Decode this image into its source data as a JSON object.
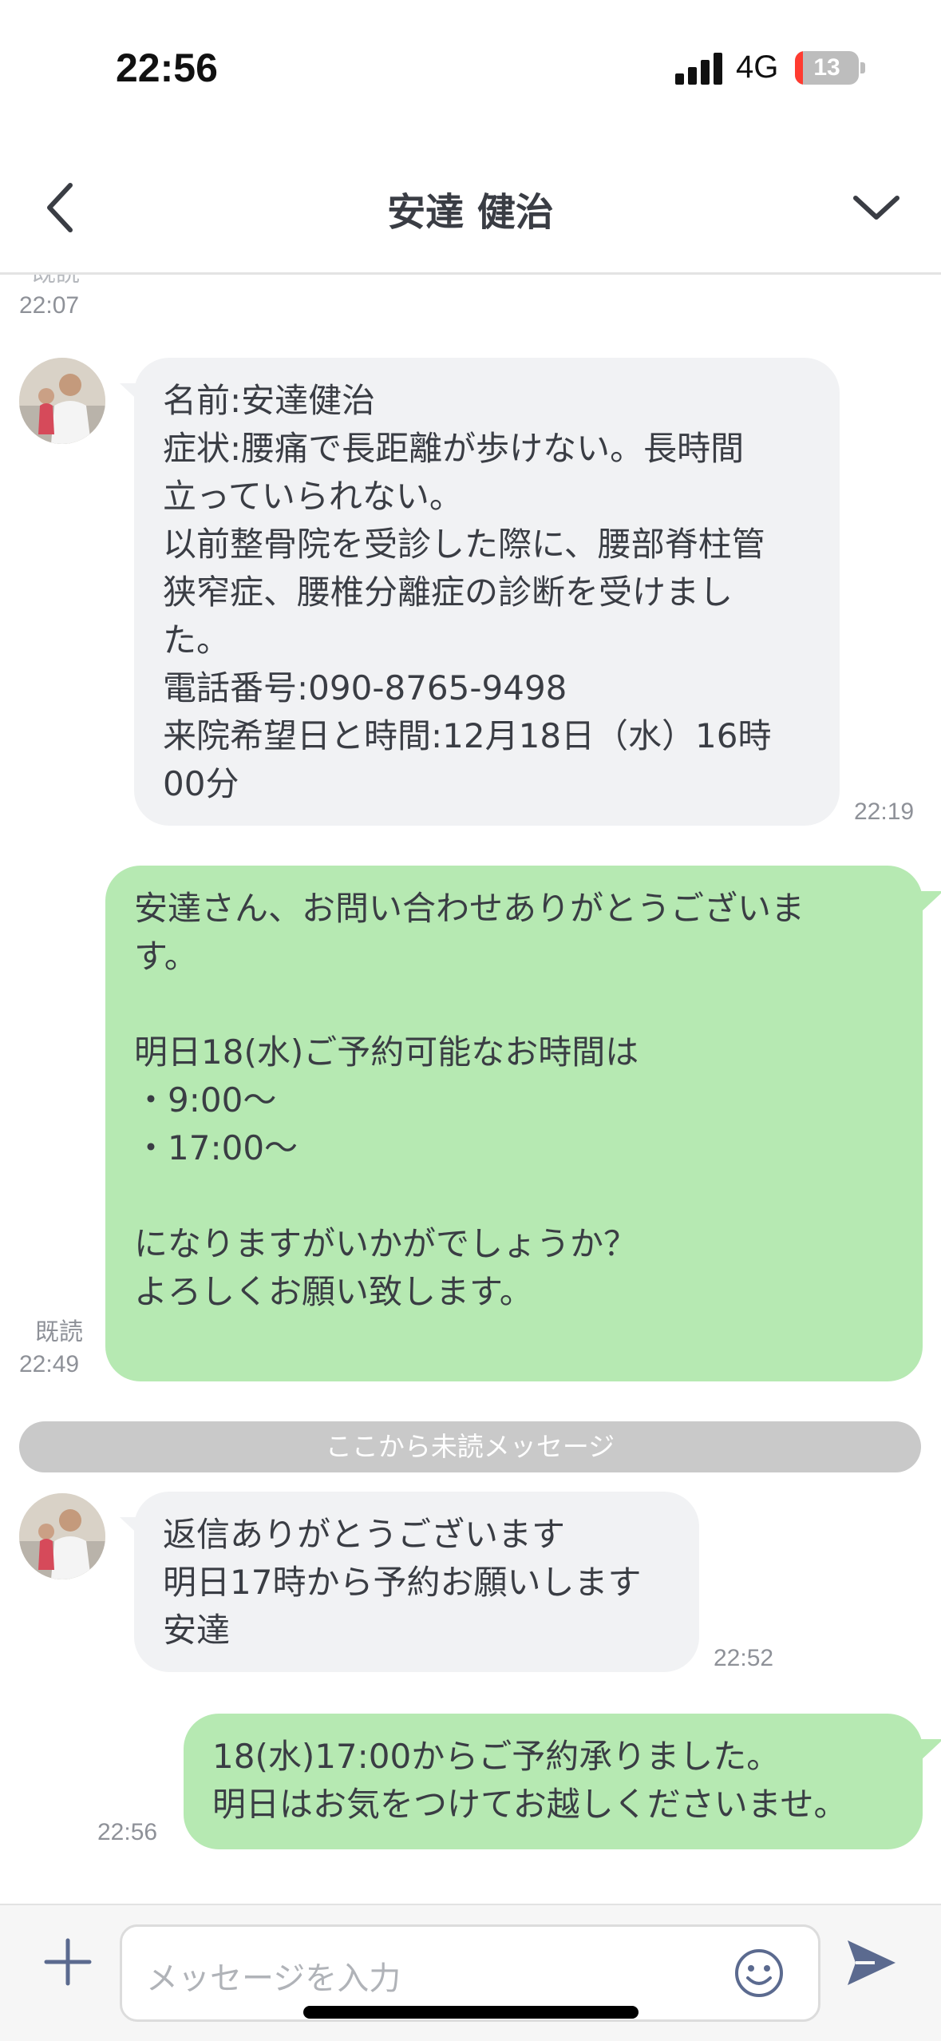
{
  "status_bar": {
    "time": "22:56",
    "network": "4G",
    "battery_level": "13",
    "battery_fraction": 0.13
  },
  "header": {
    "title": "安達 健治",
    "back_icon": "chevron-left-icon",
    "menu_icon": "chevron-down-icon"
  },
  "chat": {
    "top_partial": {
      "read_label": "既読",
      "time": "22:07"
    },
    "messages": [
      {
        "direction": "in",
        "text": "名前:安達健治\n症状:腰痛で長距離が歩けない。長時間\n立っていられない。\n以前整骨院を受診した際に、腰部脊柱管\n狭窄症、腰椎分離症の診断を受けまし\nた。\n電話番号:090-8765-9498\n来院希望日と時間:12月18日（水）16時\n00分",
        "time": "22:19"
      },
      {
        "direction": "out",
        "text": "安達さん、お問い合わせありがとうございま\nす。\n\n明日18(水)ご予約可能なお時間は\n・9:00〜\n・17:00〜\n\nになりますがいかがでしょうか？\nよろしくお願い致します。",
        "read_label": "既読",
        "time": "22:49"
      },
      {
        "direction": "in",
        "text": "返信ありがとうございます\n明日17時から予約お願いします\n安達",
        "time": "22:52"
      },
      {
        "direction": "out",
        "text": "18(水)17:00からご予約承りました。\n明日はお気をつけてお越しくださいませ。",
        "time": "22:56"
      }
    ],
    "unread_divider": "ここから未読メッセージ"
  },
  "input_bar": {
    "placeholder": "メッセージを入力",
    "plus_icon": "plus-icon",
    "emoji_icon": "smiley-icon",
    "send_icon": "send-icon"
  },
  "colors": {
    "outgoing_bubble": "#b6e9b2",
    "incoming_bubble": "#f1f2f4",
    "send_icon": "#5b6a8f"
  }
}
